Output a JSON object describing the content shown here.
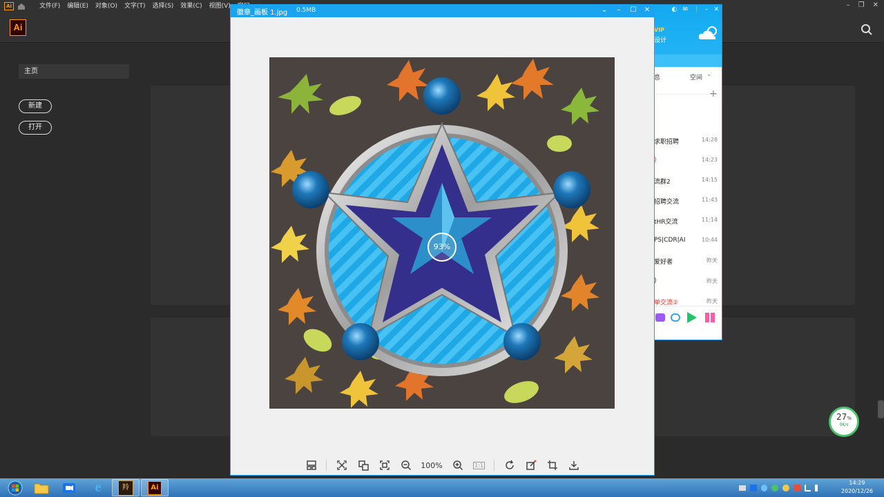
{
  "illustrator": {
    "logo": "Ai",
    "menu": [
      "文件(F)",
      "编辑(E)",
      "对象(O)",
      "文字(T)",
      "选择(S)",
      "效果(C)",
      "视图(V)",
      "窗口"
    ],
    "home": "主页",
    "new_button": "新建",
    "open_button": "打开"
  },
  "viewer": {
    "title": "徽章_画板 1.jpg",
    "size": "0.5MB",
    "progress": "93%",
    "zoom": "100%",
    "zoom_ratio_icon": "1:1"
  },
  "chat": {
    "vip": "VIP",
    "design": "设计",
    "tab_messages": "息",
    "tab_space": "空间",
    "rows": [
      {
        "name": "求职招聘",
        "time": "14:28",
        "red": false
      },
      {
        "name": ")",
        "time": "14:23",
        "red": true
      },
      {
        "name": "流群2",
        "time": "14:15",
        "red": false
      },
      {
        "name": "招聘交流",
        "time": "11:43",
        "red": false
      },
      {
        "name": "tHR交流",
        "time": "11:14",
        "red": false
      },
      {
        "name": "PS|CDR|AI",
        "time": "10:44",
        "red": false
      },
      {
        "name": "爱好者",
        "time": "昨天",
        "red": false
      },
      {
        "name": ")",
        "time": "昨天",
        "red": false
      },
      {
        "name": "单交流②",
        "time": "昨天",
        "red": true
      }
    ]
  },
  "speed_widget": {
    "percent": "27",
    "unit": "%",
    "rate": "0K/s"
  },
  "taskbar": {
    "time": "14:29",
    "date": "2020/12/26",
    "game_label": "羚"
  },
  "colors": {
    "accent": "#1aa4ef",
    "ai_orange": "#ff9a00",
    "dark": "#2b2b2b"
  }
}
